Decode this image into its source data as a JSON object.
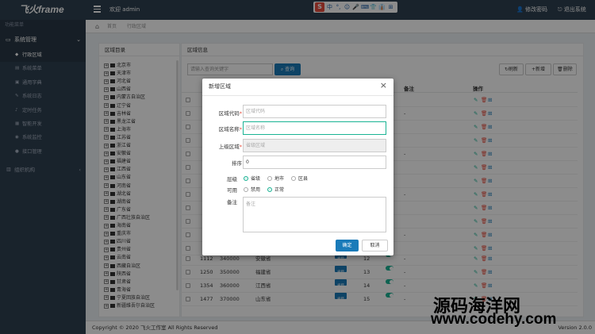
{
  "app": {
    "logo": "飞火frame",
    "welcome": "欢迎 admin",
    "change_password": "修改密码",
    "logout": "退出系统"
  },
  "top_toolbar": {
    "logo_letter": "S",
    "items": [
      "中",
      "°,",
      "☺",
      "🎤",
      "⌨",
      "👕",
      "👔",
      "⊞"
    ]
  },
  "sidebar": {
    "header": "功能菜单",
    "group": "系统管理",
    "items": [
      "行政区域",
      "系统菜单",
      "通用字典",
      "系统日志",
      "定时任务",
      "智能开发",
      "系统监控",
      "接口管理"
    ],
    "active_index": 0,
    "other_group": "组织机构"
  },
  "tabs": {
    "home": "首页",
    "current": "行政区域"
  },
  "tree_panel": {
    "title": "区域目录",
    "items": [
      "北京市",
      "天津市",
      "河北省",
      "山西省",
      "内蒙古自治区",
      "辽宁省",
      "吉林省",
      "黑龙江省",
      "上海市",
      "江苏省",
      "浙江省",
      "安徽省",
      "福建省",
      "江西省",
      "山东省",
      "河南省",
      "湖北省",
      "湖南省",
      "广东省",
      "广西壮族自治区",
      "海南省",
      "重庆市",
      "四川省",
      "贵州省",
      "云南省",
      "西藏自治区",
      "陕西省",
      "甘肃省",
      "青海省",
      "宁夏回族自治区",
      "新疆维吾尔自治区"
    ]
  },
  "info_panel": {
    "title": "区域信息",
    "search_placeholder": "请输入查询关键字",
    "search_button": "查询",
    "refresh_button": "刷新",
    "add_button": "新增",
    "delete_button": "删除",
    "col_remark": "备注",
    "col_actions": "操作",
    "rows": [
      {
        "id": "1112",
        "code": "340000",
        "name": "安徽省",
        "level": "省级",
        "sort": "12"
      },
      {
        "id": "1250",
        "code": "350000",
        "name": "福建省",
        "level": "省级",
        "sort": "13"
      },
      {
        "id": "1354",
        "code": "360000",
        "name": "江西省",
        "level": "省级",
        "sort": "14"
      },
      {
        "id": "1477",
        "code": "370000",
        "name": "山东省",
        "level": "省级",
        "sort": "15"
      }
    ],
    "row_dashes": [
      "-",
      "-",
      "-",
      "-",
      "-",
      "-",
      "-",
      "-",
      "-"
    ]
  },
  "modal": {
    "title": "新增区域",
    "close": "×",
    "code_label": "区域代码",
    "code_placeholder": "区域代码",
    "name_label": "区域名称",
    "name_placeholder": "区域名称",
    "parent_label": "上级区域",
    "parent_placeholder": "省级区域",
    "sort_label": "排序",
    "sort_value": "0",
    "level_label": "层级",
    "level_options": [
      "省级",
      "地市",
      "区县"
    ],
    "enabled_label": "可用",
    "enabled_options": [
      "禁用",
      "正常"
    ],
    "remark_label": "备注",
    "remark_placeholder": "备注",
    "confirm_button": "确定",
    "cancel_button": "取消"
  },
  "footer": {
    "copyright": "Copyright © 2020 飞火工作室 All Rights Reserved",
    "version": "Version 2.0.0"
  },
  "watermark": {
    "line1": "源码海洋网",
    "line2": "www.codehy.com"
  },
  "colors": {
    "sidebar_bg": "#2f4050",
    "primary": "#1a7bb9",
    "accent": "#1ab394"
  }
}
